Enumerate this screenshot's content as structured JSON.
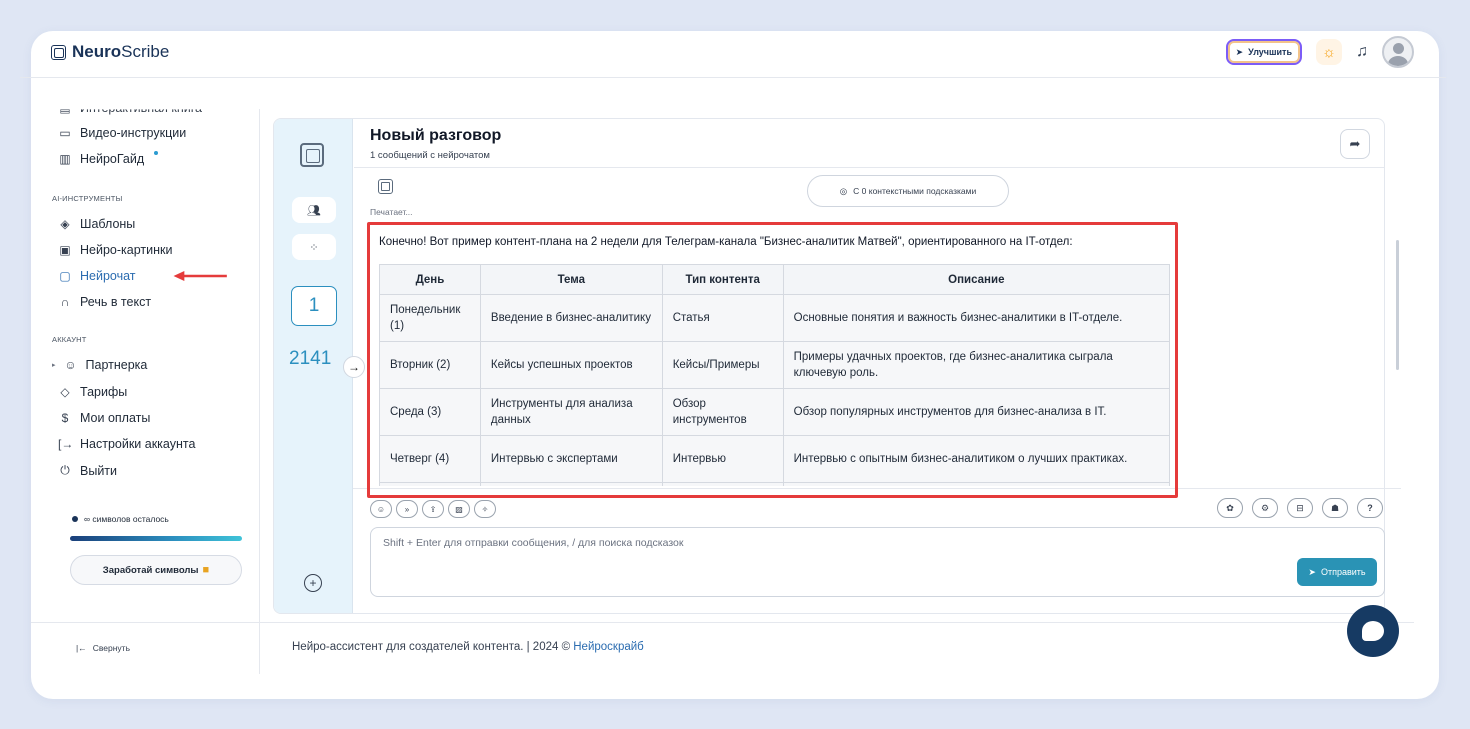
{
  "app": {
    "logo_bold": "Neuro",
    "logo_light": "Scribe",
    "upgrade_label": "Улучшить"
  },
  "sidebar": {
    "items_top": [
      {
        "label": "Интерактивная книга",
        "icon": "book-icon"
      },
      {
        "label": "Видео-инструкции",
        "icon": "video-icon"
      },
      {
        "label": "НейроГайд",
        "icon": "guide-icon"
      }
    ],
    "section_ai": "AI-ИНСТРУМЕНТЫ",
    "items_ai": [
      {
        "label": "Шаблоны",
        "icon": "layers-icon"
      },
      {
        "label": "Нейро-картинки",
        "icon": "image-icon"
      },
      {
        "label": "Нейрочат",
        "icon": "chat-icon"
      },
      {
        "label": "Речь в текст",
        "icon": "headphones-icon"
      }
    ],
    "section_account": "АККАУНТ",
    "items_account": [
      {
        "label": "Партнерка",
        "icon": "users-icon"
      },
      {
        "label": "Тарифы",
        "icon": "tag-icon"
      },
      {
        "label": "Мои оплаты",
        "icon": "dollar-icon"
      },
      {
        "label": "Настройки аккаунта",
        "icon": "login-icon"
      },
      {
        "label": "Выйти",
        "icon": "power-icon"
      }
    ],
    "symbols_left": "∞ символов осталось",
    "earn_label": "Заработай символы",
    "collapse_label": "Свернуть"
  },
  "chat": {
    "title": "Новый разговор",
    "subtitle": "1 сообщений с нейрочатом",
    "typing": "Печатает...",
    "hints": "С 0 контекстными подсказками",
    "counter": "1",
    "total": "2141",
    "intro": "Конечно! Вот пример контент-плана на 2 недели для Телеграм-канала \"Бизнес-аналитик Матвей\", ориентированного на IT-отдел:",
    "table": {
      "headers": [
        "День",
        "Тема",
        "Тип контента",
        "Описание"
      ],
      "rows": [
        [
          "Понедельник (1)",
          "Введение в бизнес-аналитику",
          "Статья",
          "Основные понятия и важность бизнес-аналитики в IT-отделе."
        ],
        [
          "Вторник (2)",
          "Кейсы успешных проектов",
          "Кейсы/Примеры",
          "Примеры удачных проектов, где бизнес-аналитика сыграла ключевую роль."
        ],
        [
          "Среда (3)",
          "Инструменты для анализа данных",
          "Обзор инструментов",
          "Обзор популярных инструментов для бизнес-анализа в IT."
        ],
        [
          "Четверг (4)",
          "Интервью с экспертами",
          "Интервью",
          "Интервью с опытным бизнес-аналитиком о лучших практиках."
        ]
      ]
    },
    "input_placeholder": "Shift + Enter для отправки сообщения, / для поиска подсказок",
    "send_label": "Отправить"
  },
  "footer": {
    "text": "Нейро-ассистент для создателей контента.  | 2024 © ",
    "link": "Нейроскрайб"
  }
}
